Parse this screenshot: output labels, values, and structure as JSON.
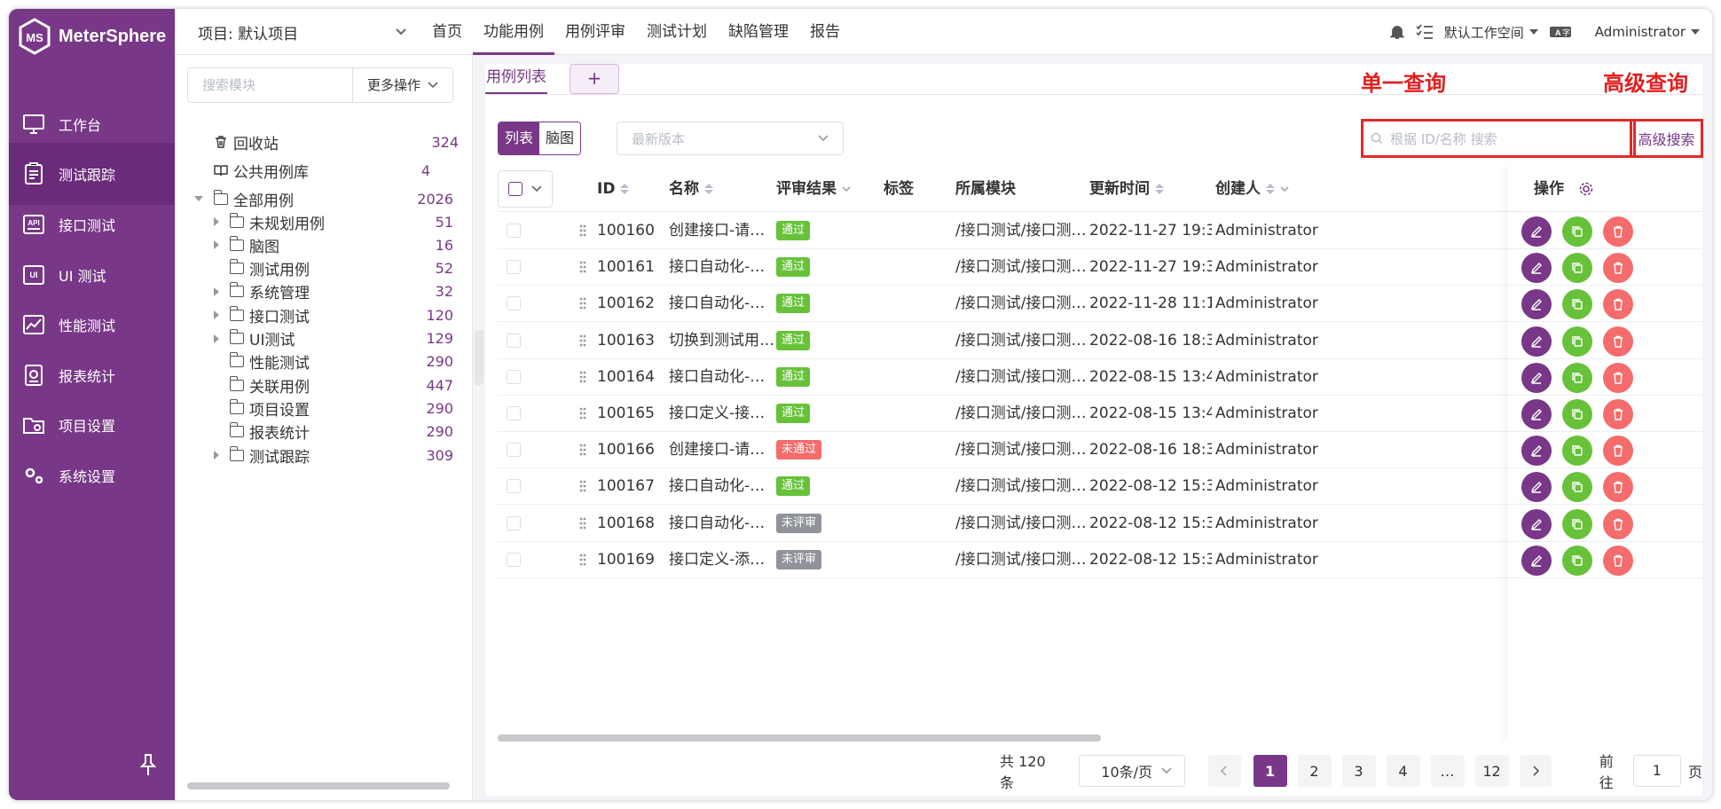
{
  "brand": {
    "name": "MeterSphere",
    "color": "#783887"
  },
  "sidebar": {
    "items": [
      {
        "label": "工作台",
        "icon": "monitor-icon"
      },
      {
        "label": "测试跟踪",
        "icon": "clipboard-icon",
        "active": true
      },
      {
        "label": "接口测试",
        "icon": "api-icon"
      },
      {
        "label": "UI 测试",
        "icon": "ui-icon"
      },
      {
        "label": "性能测试",
        "icon": "performance-chart-icon"
      },
      {
        "label": "报表统计",
        "icon": "report-icon"
      },
      {
        "label": "项目设置",
        "icon": "folder-settings-icon"
      },
      {
        "label": "系统设置",
        "icon": "gears-icon"
      }
    ]
  },
  "topbar": {
    "project": "项目: 默认项目",
    "menu": [
      "首页",
      "功能用例",
      "用例评审",
      "测试计划",
      "缺陷管理",
      "报告"
    ],
    "active_menu": "功能用例",
    "workspace": "默认工作空间",
    "user": "Administrator"
  },
  "tree": {
    "search_placeholder": "搜索模块",
    "more_actions": "更多操作",
    "recycle": {
      "label": "回收站",
      "count": "324"
    },
    "public": {
      "label": "公共用例库",
      "count": "4"
    },
    "root": {
      "label": "全部用例",
      "count": "2026"
    },
    "nodes": [
      {
        "label": "未规划用例",
        "count": "51",
        "expandable": true
      },
      {
        "label": "脑图",
        "count": "16",
        "expandable": true
      },
      {
        "label": "测试用例",
        "count": "52",
        "expandable": false
      },
      {
        "label": "系统管理",
        "count": "32",
        "expandable": true
      },
      {
        "label": "接口测试",
        "count": "120",
        "expandable": true
      },
      {
        "label": "UI测试",
        "count": "129",
        "expandable": true
      },
      {
        "label": "性能测试",
        "count": "290",
        "expandable": false
      },
      {
        "label": "关联用例",
        "count": "447",
        "expandable": false
      },
      {
        "label": "项目设置",
        "count": "290",
        "expandable": false
      },
      {
        "label": "报表统计",
        "count": "290",
        "expandable": false
      },
      {
        "label": "测试跟踪",
        "count": "309",
        "expandable": true
      }
    ]
  },
  "main": {
    "tab": "用例列表",
    "tab_add": "+",
    "view_list": "列表",
    "view_mind": "脑图",
    "version_placeholder": "最新版本",
    "search_placeholder": "根据 ID/名称 搜索",
    "advanced_search": "高级搜索",
    "annotation_single": "单一查询",
    "annotation_advanced": "高级查询",
    "columns": {
      "id": "ID",
      "name": "名称",
      "review": "评审结果",
      "tags": "标签",
      "module": "所属模块",
      "updated": "更新时间",
      "creator": "创建人",
      "ops": "操作"
    },
    "rows": [
      {
        "id": "100160",
        "name": "创建接口-请…",
        "status": "通过",
        "module": "/接口测试/接口测…",
        "updated": "2022-11-27 19:3…",
        "creator": "Administrator"
      },
      {
        "id": "100161",
        "name": "接口自动化-…",
        "status": "通过",
        "module": "/接口测试/接口测…",
        "updated": "2022-11-27 19:3…",
        "creator": "Administrator"
      },
      {
        "id": "100162",
        "name": "接口自动化-…",
        "status": "通过",
        "module": "/接口测试/接口测…",
        "updated": "2022-11-28 11:1…",
        "creator": "Administrator"
      },
      {
        "id": "100163",
        "name": "切换到测试用…",
        "status": "通过",
        "module": "/接口测试/接口测…",
        "updated": "2022-08-16 18:3…",
        "creator": "Administrator"
      },
      {
        "id": "100164",
        "name": "接口自动化-…",
        "status": "通过",
        "module": "/接口测试/接口测…",
        "updated": "2022-08-15 13:4…",
        "creator": "Administrator"
      },
      {
        "id": "100165",
        "name": "接口定义-接…",
        "status": "通过",
        "module": "/接口测试/接口测…",
        "updated": "2022-08-15 13:4…",
        "creator": "Administrator"
      },
      {
        "id": "100166",
        "name": "创建接口-请…",
        "status": "未通过",
        "module": "/接口测试/接口测…",
        "updated": "2022-08-16 18:3…",
        "creator": "Administrator"
      },
      {
        "id": "100167",
        "name": "接口自动化-…",
        "status": "通过",
        "module": "/接口测试/接口测…",
        "updated": "2022-08-12 15:3…",
        "creator": "Administrator"
      },
      {
        "id": "100168",
        "name": "接口自动化-…",
        "status": "未评审",
        "module": "/接口测试/接口测…",
        "updated": "2022-08-12 15:3…",
        "creator": "Administrator"
      },
      {
        "id": "100169",
        "name": "接口定义-添…",
        "status": "未评审",
        "module": "/接口测试/接口测…",
        "updated": "2022-08-12 15:3…",
        "creator": "Administrator"
      }
    ],
    "status_colors": {
      "通过": "#67c23a",
      "未通过": "#f56c6c",
      "未评审": "#909399"
    },
    "pagination": {
      "total": "共 120 条",
      "page_size": "10条/页",
      "pages": [
        "1",
        "2",
        "3",
        "4",
        "…",
        "12"
      ],
      "current": "1",
      "goto_prefix": "前往",
      "goto_value": "1",
      "goto_suffix": "页"
    }
  }
}
